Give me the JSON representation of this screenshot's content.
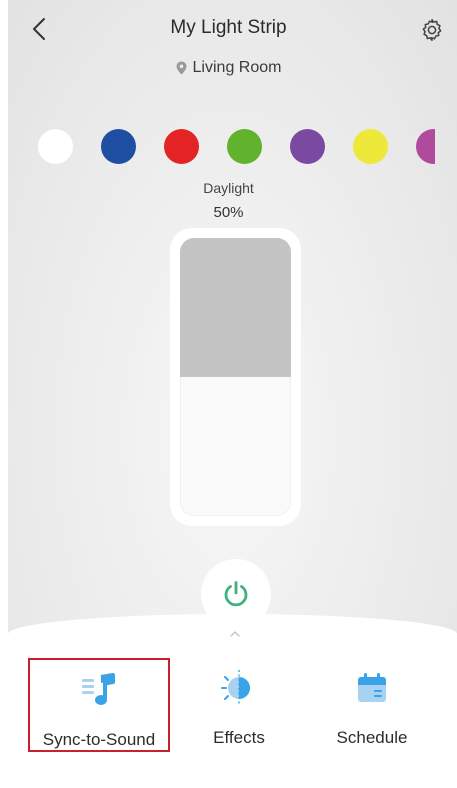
{
  "header": {
    "title": "My Light Strip",
    "location": "Living Room",
    "icons": {
      "back": "chevron-left-icon",
      "settings": "gear-icon",
      "location": "map-pin-icon"
    }
  },
  "colors": [
    "#ffffff",
    "#1e4fa3",
    "#e42424",
    "#61b22d",
    "#7a4aa3",
    "#ece93a",
    "#b04a9c"
  ],
  "brightness": {
    "mode": "Daylight",
    "value": "50%",
    "level": 0.5
  },
  "power": {
    "icon": "power-icon",
    "accent": "#3fb27f"
  },
  "actions": [
    {
      "label": "Sync-to-Sound",
      "icon": "music-note-icon",
      "selected": true
    },
    {
      "label": "Effects",
      "icon": "effects-icon"
    },
    {
      "label": "Schedule",
      "icon": "calendar-icon"
    }
  ],
  "accent_color": "#3aa3e8",
  "highlight_color": "#c8202c"
}
